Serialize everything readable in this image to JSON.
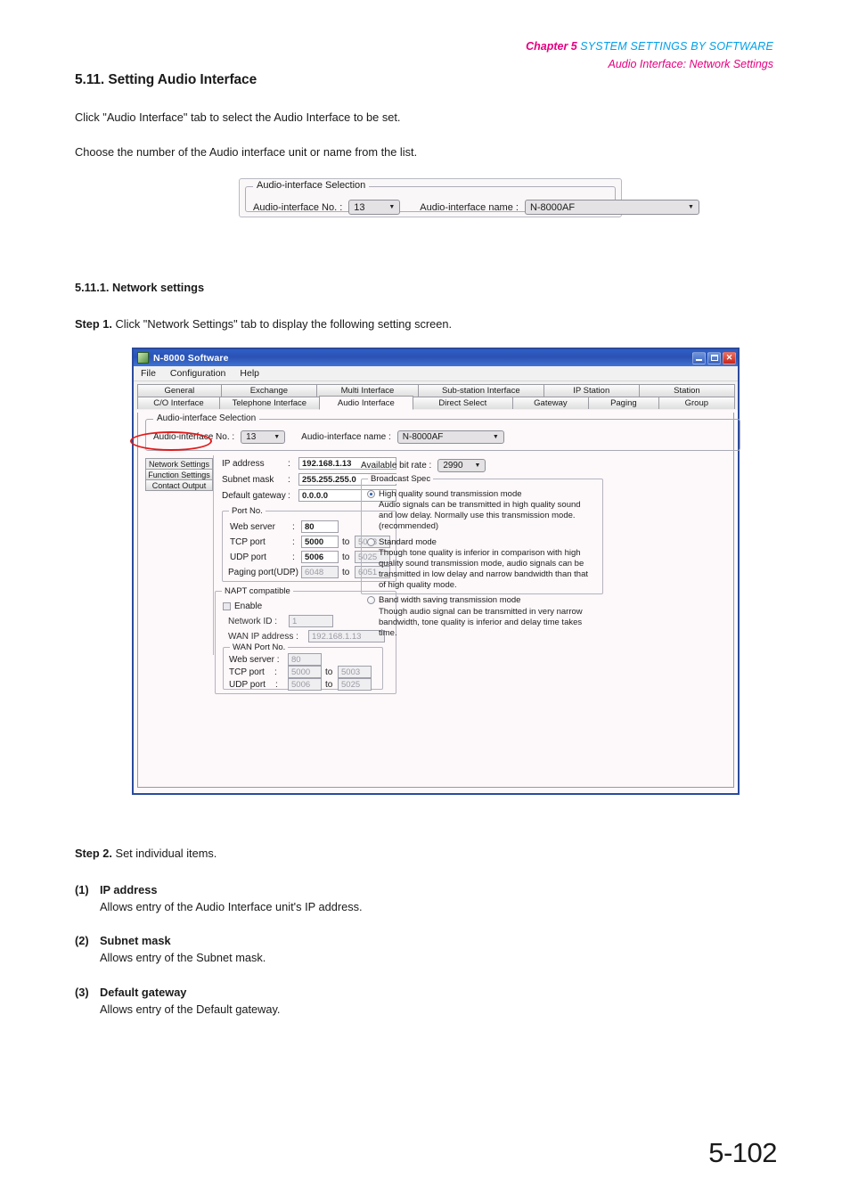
{
  "header": {
    "chapter": "Chapter 5",
    "chapter_title": "SYSTEM SETTINGS BY SOFTWARE",
    "subtitle": "Audio Interface: Network Settings"
  },
  "page_number": "5-102",
  "section": {
    "title": "5.11. Setting Audio Interface",
    "intro1": "Click \"Audio Interface\" tab to select the Audio Interface to be set.",
    "intro2": "Choose the number of the Audio interface unit or name from the list.",
    "subsection_title": "5.11.1. Network settings",
    "step1_label": "Step 1.",
    "step1_text": "Click \"Network Settings\" tab to display the following setting screen.",
    "step2_label": "Step 2.",
    "step2_text": "Set individual items."
  },
  "items": [
    {
      "num": "(1)",
      "name": "IP address",
      "desc": "Allows entry of the Audio Interface unit's IP address."
    },
    {
      "num": "(2)",
      "name": "Subnet mask",
      "desc": "Allows entry of the Subnet mask."
    },
    {
      "num": "(3)",
      "name": "Default gateway",
      "desc": "Allows entry of the Default gateway."
    }
  ],
  "figure_selection": {
    "legend": "Audio-interface Selection",
    "no_label": "Audio-interface No. :",
    "no_value": "13",
    "name_label": "Audio-interface name :",
    "name_value": "N-8000AF"
  },
  "app": {
    "title": "N-8000 Software",
    "menu": [
      "File",
      "Configuration",
      "Help"
    ],
    "window_buttons": {
      "minimize": "minimize-icon",
      "maximize": "maximize-icon",
      "close": "✕"
    },
    "tabs_row1": [
      "General",
      "Exchange",
      "Multi Interface",
      "Sub-station Interface",
      "IP Station",
      "Station"
    ],
    "tabs_row2": [
      "C/O Interface",
      "Telephone Interface",
      "Audio Interface",
      "Direct Select",
      "Gateway",
      "Paging",
      "Group"
    ],
    "active_tab": "Audio Interface",
    "selection": {
      "legend": "Audio-interface Selection",
      "no_label": "Audio-interface No. :",
      "no_value": "13",
      "name_label": "Audio-interface name :",
      "name_value": "N-8000AF"
    },
    "side_tabs": [
      "Network Settings",
      "Function Settings",
      "Contact Output"
    ],
    "active_side_tab": "Network Settings",
    "network": {
      "ip_label": "IP address",
      "ip_value": "192.168.1.13",
      "subnet_label": "Subnet mask",
      "subnet_value": "255.255.255.0",
      "gateway_label": "Default gateway",
      "gateway_value": "0.0.0.0",
      "colon": ":"
    },
    "port_group": {
      "legend": "Port No.",
      "rows": [
        {
          "label": "Web server",
          "colon": ":",
          "from": "80",
          "to_label": "",
          "to": ""
        },
        {
          "label": "TCP port",
          "colon": ":",
          "from": "5000",
          "to_label": "to",
          "to": "5003"
        },
        {
          "label": "UDP port",
          "colon": ":",
          "from": "5006",
          "to_label": "to",
          "to": "5025"
        },
        {
          "label": "Paging port(UDP)",
          "colon": ":",
          "from": "6048",
          "to_label": "to",
          "to": "6051"
        }
      ]
    },
    "napt": {
      "legend": "NAPT compatible",
      "enable_label": "Enable",
      "enable_checked": false,
      "network_id_label": "Network ID :",
      "network_id_value": "1",
      "wan_ip_label": "WAN IP address :",
      "wan_ip_value": "192.168.1.13",
      "wan_port_legend": "WAN Port No.",
      "wan_rows": [
        {
          "label": "Web server :",
          "from": "80",
          "to_label": "",
          "to": ""
        },
        {
          "label": "TCP port    :",
          "from": "5000",
          "to_label": "to",
          "to": "5003"
        },
        {
          "label": "UDP port    :",
          "from": "5006",
          "to_label": "to",
          "to": "5025"
        }
      ]
    },
    "bitrate": {
      "label": "Available bit rate :",
      "value": "2990"
    },
    "broadcast": {
      "legend": "Broadcast Spec",
      "options": [
        {
          "selected": true,
          "title": "High quality sound transmission mode",
          "desc": "Audio signals can be transmitted in high quality sound and low delay. Normally use this transmission mode.(recommended)"
        },
        {
          "selected": false,
          "title": "Standard mode",
          "desc": "Though tone quality is inferior in comparison with high quality sound transmission mode, audio signals can be transmitted in low delay and narrow bandwidth than that of high quality mode."
        },
        {
          "selected": false,
          "title": "Band width saving transmission mode",
          "desc": "Though audio signal can be transmitted in very narrow bandwidth, tone quality is inferior and delay time takes time."
        }
      ]
    }
  },
  "colors": {
    "chapter_pink": "#e5007f",
    "title_blue": "#00a0e9",
    "window_border": "#2a4a9c",
    "annotation_red": "#e01b1b"
  }
}
